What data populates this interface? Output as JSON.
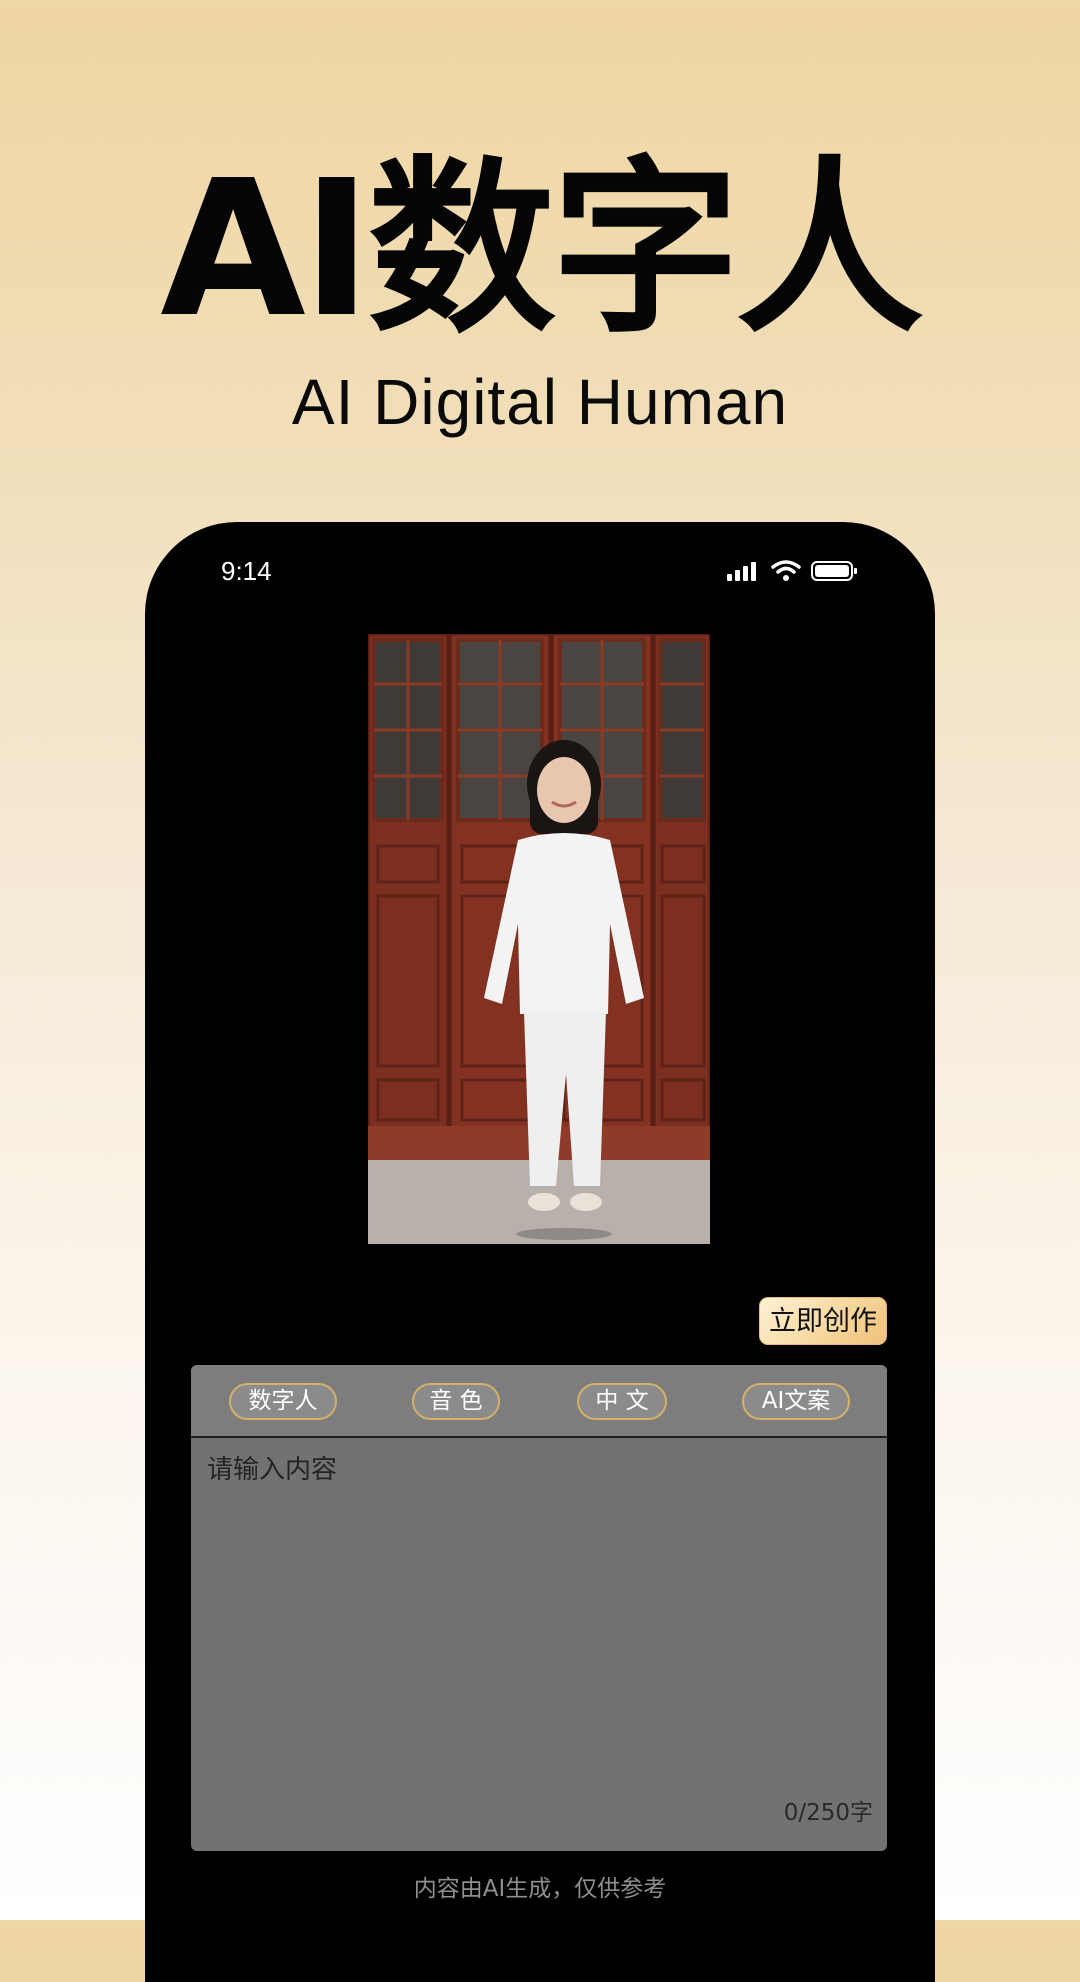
{
  "hero": {
    "title": "AI数字人",
    "subtitle": "AI Digital Human"
  },
  "status_bar": {
    "time": "9:14",
    "icons": [
      "cellular-signal-icon",
      "wifi-icon",
      "battery-icon"
    ]
  },
  "preview": {
    "image": "digital-human-preview-image"
  },
  "actions": {
    "create_label": "立即创作"
  },
  "editor": {
    "tabs": [
      {
        "label": "数字人"
      },
      {
        "label": "音 色"
      },
      {
        "label": "中 文"
      },
      {
        "label": "AI文案"
      }
    ],
    "placeholder": "请输入内容",
    "counter": "0/250字"
  },
  "footer": {
    "disclaimer": "内容由AI生成，仅供参考"
  },
  "colors": {
    "accent_gold": "#d5b06b",
    "phone_frame": "#000000",
    "editor_background": "#727272"
  }
}
